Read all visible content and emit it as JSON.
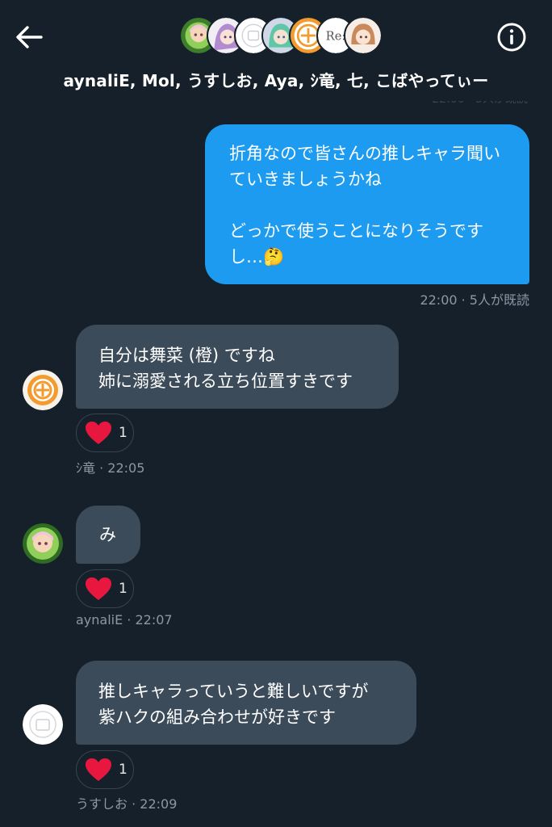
{
  "header": {
    "group_name": "aynaliE, Mol, うすしお, Aya, ｼ竜, 七, こばやってぃー",
    "back_icon": "back-arrow-icon",
    "info_icon": "info-icon",
    "members": [
      "aynaliE",
      "Mol",
      "うすしお",
      "Aya",
      "ｼ竜",
      "七",
      "こばやってぃー"
    ],
    "avatar_labels": {
      "seven": "Re:"
    }
  },
  "messages": [
    {
      "type": "sent",
      "text": "折角なので皆さんの推しキャラ聞いていきましょうかね\n\nどっかで使うことになりそうですし…🤔",
      "time": "22:00",
      "read_status": "5人が既読",
      "meta": "22:00 · 5人が既読"
    },
    {
      "type": "received",
      "sender": "ｼ竜",
      "text": "自分は舞菜 (橙) ですね\n姉に溺愛される立ち位置すきです",
      "time": "22:05",
      "meta": "ｼ竜 · 22:05",
      "reaction": {
        "emoji": "heart-icon",
        "count": "1"
      }
    },
    {
      "type": "received",
      "sender": "aynaliE",
      "text": "み",
      "time": "22:07",
      "meta": "aynaliE · 22:07",
      "reaction": {
        "emoji": "heart-icon",
        "count": "1"
      }
    },
    {
      "type": "received",
      "sender": "うすしお",
      "text": "推しキャラっていうと難しいですが\n紫ハクの組み合わせが好きです",
      "time": "22:09",
      "meta": "うすしお · 22:09",
      "reaction": {
        "emoji": "heart-icon",
        "count": "1"
      }
    }
  ],
  "colors": {
    "background": "#15202b",
    "sent_bubble": "#1d9bf0",
    "received_bubble": "#3c4b59",
    "heart": "#f91880",
    "meta_text": "#8b98a5"
  }
}
